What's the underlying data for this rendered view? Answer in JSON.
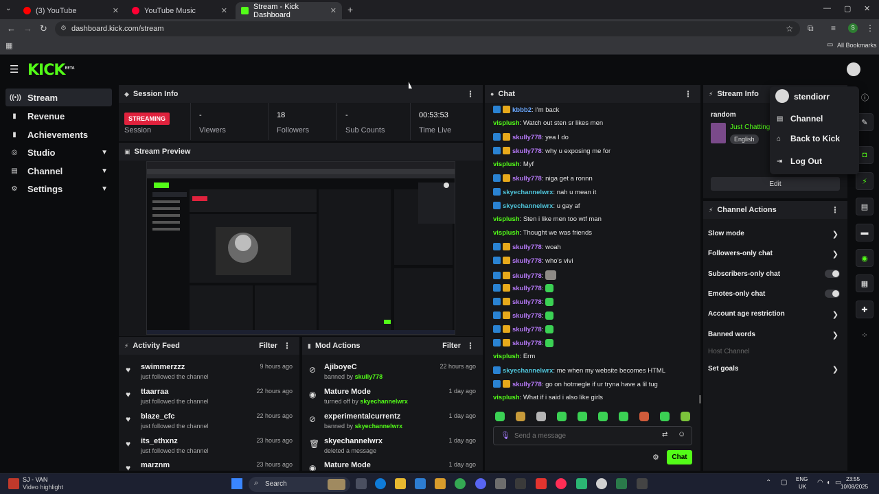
{
  "browser": {
    "tabs": [
      {
        "title": "(3) YouTube",
        "favicon_color": "#ff0000"
      },
      {
        "title": "YouTube Music",
        "favicon_color": "#ff0033"
      },
      {
        "title": "Stream - Kick Dashboard",
        "favicon_color": "#53fc18"
      }
    ],
    "url": "dashboard.kick.com/stream",
    "bookmarks_label": "All Bookmarks",
    "profile_initial": "S"
  },
  "app": {
    "logo": "KICK",
    "logo_tag": "BETA",
    "accent": "#53fc18"
  },
  "sidebar": {
    "items": [
      {
        "label": "Stream",
        "icon": "broadcast-icon",
        "active": true
      },
      {
        "label": "Revenue",
        "icon": "revenue-icon"
      },
      {
        "label": "Achievements",
        "icon": "trophy-icon"
      },
      {
        "label": "Studio",
        "icon": "studio-icon",
        "expandable": true
      },
      {
        "label": "Channel",
        "icon": "channel-icon",
        "expandable": true
      },
      {
        "label": "Settings",
        "icon": "gear-icon",
        "expandable": true
      }
    ]
  },
  "session_info": {
    "title": "Session Info",
    "status_badge": "STREAMING",
    "stats": [
      {
        "value": "",
        "label": "Session"
      },
      {
        "value": "-",
        "label": "Viewers"
      },
      {
        "value": "18",
        "label": "Followers"
      },
      {
        "value": "-",
        "label": "Sub Counts"
      },
      {
        "value": "00:53:53",
        "label": "Time Live"
      }
    ]
  },
  "stream_preview": {
    "title": "Stream Preview"
  },
  "activity_feed": {
    "title": "Activity Feed",
    "filter_label": "Filter",
    "items": [
      {
        "name": "swimmerzzz",
        "sub": "just followed the channel",
        "time": "9 hours ago"
      },
      {
        "name": "ttaarraa",
        "sub": "just followed the channel",
        "time": "22 hours ago"
      },
      {
        "name": "blaze_cfc",
        "sub": "just followed the channel",
        "time": "22 hours ago"
      },
      {
        "name": "its_ethxnz",
        "sub": "just followed the channel",
        "time": "23 hours ago"
      },
      {
        "name": "marznm",
        "sub": "",
        "time": "23 hours ago"
      }
    ]
  },
  "mod_actions": {
    "title": "Mod Actions",
    "filter_label": "Filter",
    "items": [
      {
        "name": "AjiboyeC",
        "prefix": "banned by",
        "by": "skully778",
        "time": "22 hours ago",
        "icon": "ban-icon"
      },
      {
        "name": "Mature Mode",
        "prefix": "turned off by",
        "by": "skyechannelwrx",
        "time": "1 day ago",
        "icon": "eye-icon"
      },
      {
        "name": "experimentalcurrentz",
        "prefix": "banned by",
        "by": "skyechannelwrx",
        "time": "1 day ago",
        "icon": "ban-icon"
      },
      {
        "name": "skyechannelwrx",
        "prefix": "deleted a message",
        "by": "",
        "time": "1 day ago",
        "icon": "trash-icon"
      },
      {
        "name": "Mature Mode",
        "prefix": "",
        "by": "",
        "time": "1 day ago",
        "icon": "eye-icon"
      }
    ]
  },
  "chat": {
    "title": "Chat",
    "input_placeholder": "Send a message",
    "send_label": "Chat",
    "messages": [
      {
        "user": "kbbb2",
        "color": "#6aa8ff",
        "badges": [
          "blue",
          "gold"
        ],
        "text": "I'm back"
      },
      {
        "user": "visplush",
        "color": "#53fc18",
        "badges": [],
        "text": "Watch out sten sr likes men"
      },
      {
        "user": "skully778",
        "color": "#b478f5",
        "badges": [
          "blue",
          "gold"
        ],
        "text": "yea I do"
      },
      {
        "user": "skully778",
        "color": "#b478f5",
        "badges": [
          "blue",
          "gold"
        ],
        "text": "why u exposing me for"
      },
      {
        "user": "visplush",
        "color": "#53fc18",
        "badges": [],
        "text": "Myf"
      },
      {
        "user": "skully778",
        "color": "#b478f5",
        "badges": [
          "blue",
          "gold"
        ],
        "text": "niga get a ronnn"
      },
      {
        "user": "skyechannelwrx",
        "color": "#4fc3d8",
        "badges": [
          "blue"
        ],
        "text": "nah u mean it"
      },
      {
        "user": "skyechannelwrx",
        "color": "#4fc3d8",
        "badges": [
          "blue"
        ],
        "text": "u gay af"
      },
      {
        "user": "visplush",
        "color": "#53fc18",
        "badges": [],
        "text": "Sten i like men too wtf man"
      },
      {
        "user": "visplush",
        "color": "#53fc18",
        "badges": [],
        "text": "Thought we was friends"
      },
      {
        "user": "skully778",
        "color": "#b478f5",
        "badges": [
          "blue",
          "gold"
        ],
        "text": "woah"
      },
      {
        "user": "skully778",
        "color": "#b478f5",
        "badges": [
          "blue",
          "gold"
        ],
        "text": "who's vivi"
      },
      {
        "user": "skully778",
        "color": "#b478f5",
        "badges": [
          "blue",
          "gold"
        ],
        "text": "",
        "emote": "gray"
      },
      {
        "user": "skully778",
        "color": "#b478f5",
        "badges": [
          "blue",
          "gold"
        ],
        "text": "",
        "emote": "green"
      },
      {
        "user": "skully778",
        "color": "#b478f5",
        "badges": [
          "blue",
          "gold"
        ],
        "text": "",
        "emote": "green"
      },
      {
        "user": "skully778",
        "color": "#b478f5",
        "badges": [
          "blue",
          "gold"
        ],
        "text": "",
        "emote": "green"
      },
      {
        "user": "skully778",
        "color": "#b478f5",
        "badges": [
          "blue",
          "gold"
        ],
        "text": "",
        "emote": "green"
      },
      {
        "user": "skully778",
        "color": "#b478f5",
        "badges": [
          "blue",
          "gold"
        ],
        "text": "",
        "emote": "green"
      },
      {
        "user": "visplush",
        "color": "#53fc18",
        "badges": [],
        "text": "Erm"
      },
      {
        "user": "skyechannelwrx",
        "color": "#4fc3d8",
        "badges": [
          "blue"
        ],
        "text": "me when my website becomes HTML"
      },
      {
        "user": "skully778",
        "color": "#b478f5",
        "badges": [
          "blue",
          "gold"
        ],
        "text": "go on hotmegle if ur tryna have a lil tug"
      },
      {
        "user": "visplush",
        "color": "#53fc18",
        "badges": [],
        "text": "What if i said i also like girls"
      }
    ],
    "emote_bar_colors": [
      "#3bd154",
      "#c79a3a",
      "#b5b5b5",
      "#3bd154",
      "#3bd154",
      "#3bd154",
      "#3bd154",
      "#d15c3b",
      "#3bd154",
      "#7cc43b"
    ]
  },
  "stream_info": {
    "title": "Stream Info",
    "stream_title": "random",
    "category": "Just Chatting",
    "language": "English",
    "edit_label": "Edit"
  },
  "channel_actions": {
    "title": "Channel Actions",
    "items": [
      {
        "label": "Slow mode",
        "control": "chevron"
      },
      {
        "label": "Followers-only chat",
        "control": "chevron"
      },
      {
        "label": "Subscribers-only chat",
        "control": "toggle"
      },
      {
        "label": "Emotes-only chat",
        "control": "toggle"
      },
      {
        "label": "Account age restriction",
        "control": "chevron"
      },
      {
        "label": "Banned words",
        "control": "chevron"
      },
      {
        "label": "Host Channel",
        "control": "none",
        "disabled": true
      },
      {
        "label": "Set goals",
        "control": "chevron"
      }
    ]
  },
  "user_menu": {
    "username": "stendiorr",
    "items": [
      {
        "label": "Channel",
        "icon": "channel-icon"
      },
      {
        "label": "Back to Kick",
        "icon": "home-icon"
      },
      {
        "label": "Log Out",
        "icon": "logout-icon"
      }
    ]
  },
  "taskbar": {
    "weather_title": "SJ - VAN",
    "weather_sub": "Video highlight",
    "search_label": "Search",
    "lang_1": "ENG",
    "lang_2": "UK",
    "time": "23:55",
    "date": "10/08/2025"
  }
}
